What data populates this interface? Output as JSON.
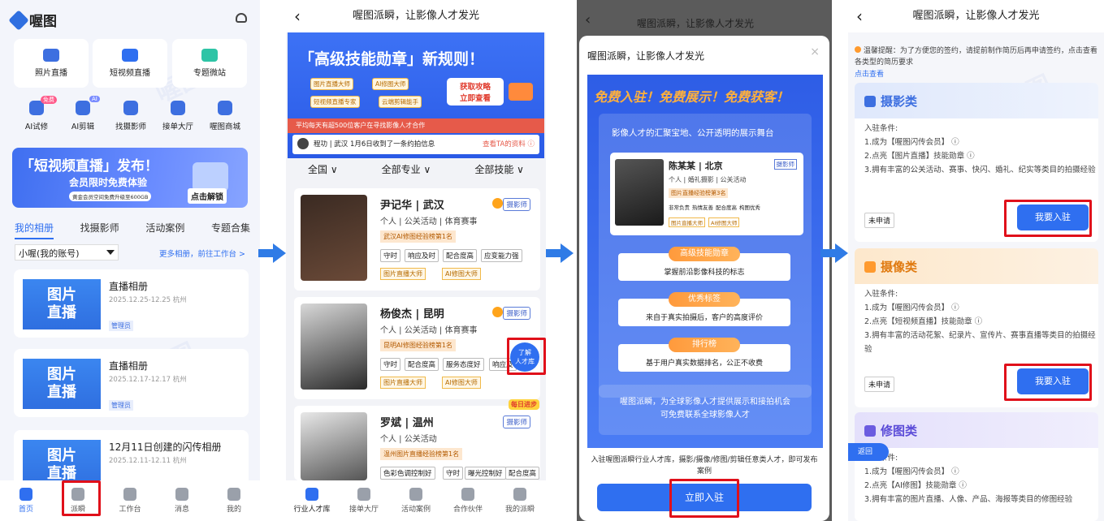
{
  "p1": {
    "app_name": "喔图",
    "services": [
      "照片直播",
      "短视频直播",
      "专题微站"
    ],
    "tools": [
      "AI试修",
      "AI剪辑",
      "找摄影师",
      "接单大厅",
      "喔图商城"
    ],
    "tool_badges": [
      "免费",
      "AI"
    ],
    "banner": {
      "title": "「短视频直播」发布！",
      "sub": "会员限时免费体验",
      "note": "黄金会员空间免费升级至600GB",
      "btn": "点击解锁"
    },
    "tabs": [
      "我的相册",
      "找摄影师",
      "活动案例",
      "专题合集"
    ],
    "account": "小喔(我的账号)",
    "more_link": "更多相册，前往工作台 >",
    "albums": [
      {
        "thumb1": "图片",
        "thumb2": "直播",
        "title": "直播相册",
        "date": "2025.12.25-12.25  杭州",
        "role": "管理员"
      },
      {
        "thumb1": "图片",
        "thumb2": "直播",
        "title": "直播相册",
        "date": "2025.12.17-12.17  杭州",
        "role": "管理员"
      },
      {
        "thumb1": "图片",
        "thumb2": "直播",
        "title": "12月11日创建的闪传相册",
        "date": "2025.12.11-12.11  杭州",
        "role": ""
      }
    ],
    "tabbar": [
      "首页",
      "派瞬",
      "工作台",
      "消息",
      "我的"
    ]
  },
  "p2": {
    "title": "喔图派瞬，让影像人才发光",
    "banner": {
      "headline": "「高级技能勋章」新规则！",
      "chips": [
        "图片直播大师",
        "AI修图大师",
        "短视频直播专家",
        "云端剪辑能手"
      ],
      "cta1": "获取攻略",
      "cta2": "立即查看",
      "ticker": "平均每天有超500位客户在寻找影像人才合作",
      "notice": "程功 | 武汉  1月6日收到了一条约拍信息",
      "notice_link": "查看TA的资料 ⓘ"
    },
    "filters": [
      "全国 ∨",
      "全部专业 ∨",
      "全部技能 ∨"
    ],
    "people": [
      {
        "name": "尹记华 | 武汉",
        "sub": "个人 | 公关活动 | 体育赛事",
        "rank": "武汉AI修图经验榜第1名",
        "kw": [
          "守时",
          "响应及时",
          "配合度高",
          "应变能力强"
        ],
        "badges": [
          "图片直播大师",
          "AI修图大师"
        ],
        "role": "摄影师"
      },
      {
        "name": "杨俊杰 | 昆明",
        "sub": "个人 | 公关活动 | 体育赛事",
        "rank": "昆明AI修图经验榜第1名",
        "kw": [
          "守时",
          "配合度高",
          "服务态度好",
          "响应及"
        ],
        "badges": [
          "图片直播大师",
          "AI修图大师"
        ],
        "role": "摄影师"
      },
      {
        "name": "罗斌 | 温州",
        "sub": "个人 | 公关活动",
        "rank": "温州图片直播经验榜第1名",
        "kw": [
          "色彩色调控制好",
          "守时",
          "曝光控制好",
          "配合度高"
        ],
        "badges": [],
        "role": "摄影师"
      }
    ],
    "float_btn": [
      "了解",
      "人才库"
    ],
    "daily": "每日进步",
    "tabbar": [
      "行业人才库",
      "接单大厅",
      "活动案例",
      "合作伙伴",
      "我的派瞬"
    ]
  },
  "p3": {
    "title": "喔图派瞬，让影像人才发光",
    "close": "×",
    "slogan": "免费入驻！免费展示！免费获客！",
    "stage": "影像人才的汇聚宝地、公开透明的展示舞台",
    "card": {
      "name": "陈某某 | 北京",
      "sub": "个人 | 婚礼摄影 | 公关活动",
      "role": "摄影师",
      "rank": "图片直播经验榜第3名",
      "kw": [
        "非常负责",
        "热情友善",
        "配合度高",
        "构图优秀"
      ],
      "badges": [
        "图片直播大师",
        "AI修图大师"
      ]
    },
    "features": [
      {
        "label": "高级技能勋章",
        "desc": "掌握前沿影像科技的标志"
      },
      {
        "label": "优秀标签",
        "desc": "来自于真实拍摄后，客户的高度评价"
      },
      {
        "label": "排行榜",
        "desc": "基于用户真实数据排名，公正不收费"
      }
    ],
    "bottom": "喔图派瞬，为全球影像人才提供展示和接拍机会\n可免费联系全球影像人才",
    "desc": "入驻喔图派瞬行业人才库，摄影/摄像/修图/剪辑任意类人才，即可发布案例",
    "button": "立即入驻"
  },
  "p4": {
    "title": "喔图派瞬，让影像人才发光",
    "tip": "温馨提醒：为了方便您的签约，请提前制作简历后再申请签约，点击查看各类型的简历要求",
    "tip_link": "点击查看",
    "cats": [
      {
        "name": "摄影类",
        "lines": [
          "入驻条件:",
          "1.成为【喔图闪传会员】 ⓘ",
          "2.点亮【图片直播】技能勋章 ⓘ",
          "3.拥有丰富的公关活动、赛事、快闪、婚礼、纪实等类目的拍摄经验"
        ],
        "status": "未申请",
        "btn": "我要入驻",
        "color": "#3d6fe0"
      },
      {
        "name": "摄像类",
        "lines": [
          "入驻条件:",
          "1.成为【喔图闪传会员】 ⓘ",
          "2.点亮【短视频直播】技能勋章 ⓘ",
          "3.拥有丰富的活动花絮、纪录片、宣传片、赛事直播等类目的拍摄经验"
        ],
        "status": "未申请",
        "btn": "我要入驻",
        "color": "#ff9a2e"
      },
      {
        "name": "修图类",
        "lines": [
          "入驻条件:",
          "1.成为【喔图闪传会员】 ⓘ",
          "2.点亮【AI修图】技能勋章 ⓘ",
          "3.拥有丰富的图片直播、人像、产品、海报等类目的修图经验"
        ],
        "status": "",
        "btn": "",
        "color": "#6b5ce0"
      }
    ],
    "back": "返回"
  }
}
